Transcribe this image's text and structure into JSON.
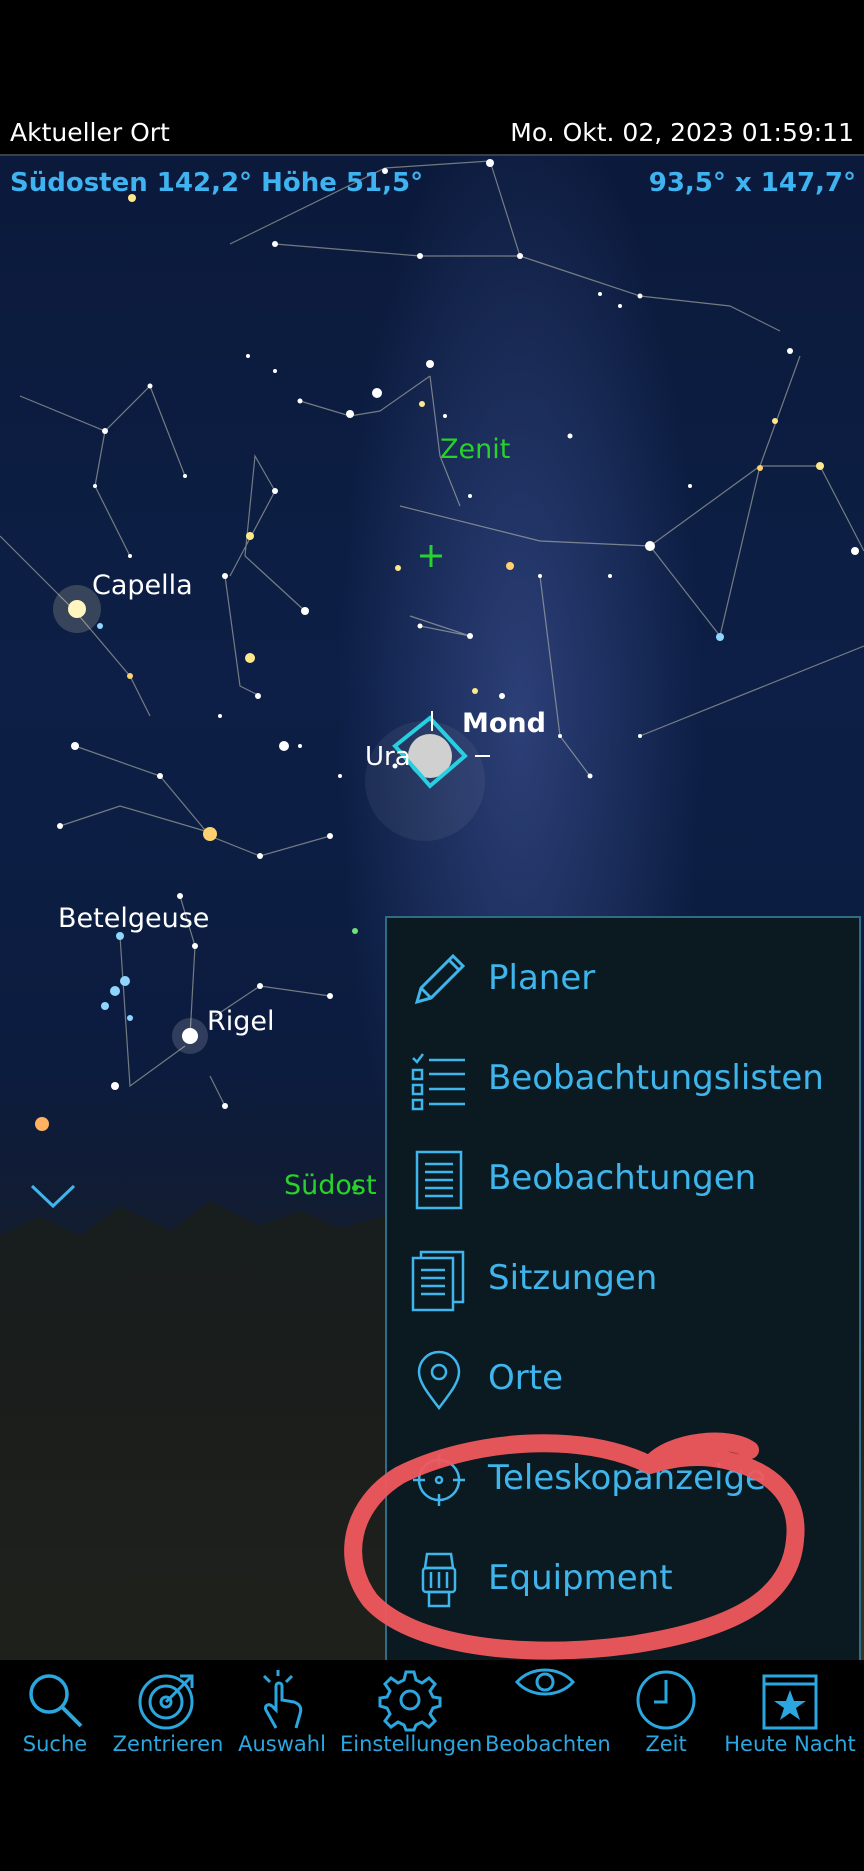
{
  "header": {
    "location": "Aktueller Ort",
    "datetime": "Mo. Okt. 02, 2023  01:59:11"
  },
  "sky": {
    "direction_info": "Südosten  142,2° Höhe 51,5°",
    "fov_info": "93,5° x 147,7°",
    "labels": {
      "zenit": "Zenit",
      "capella": "Capella",
      "mond": "Mond",
      "uranus": "Ura",
      "betelgeuse": "Betelgeuse",
      "rigel": "Rigel",
      "horizon": "Südost"
    }
  },
  "menu": {
    "items": [
      {
        "label": "Planer",
        "icon": "pencil-icon"
      },
      {
        "label": "Beobachtungslisten",
        "icon": "checklist-icon"
      },
      {
        "label": "Beobachtungen",
        "icon": "document-icon"
      },
      {
        "label": "Sitzungen",
        "icon": "documents-stack-icon"
      },
      {
        "label": "Orte",
        "icon": "location-pin-icon"
      },
      {
        "label": "Teleskopanzeige",
        "icon": "telescope-reticle-icon"
      },
      {
        "label": "Equipment",
        "icon": "eyepiece-icon"
      }
    ]
  },
  "toolbar": {
    "items": [
      {
        "label": "Suche",
        "icon": "search-icon"
      },
      {
        "label": "Zentrieren",
        "icon": "target-icon"
      },
      {
        "label": "Auswahl",
        "icon": "hand-pointer-icon"
      },
      {
        "label": "Einstellungen",
        "icon": "gear-icon"
      },
      {
        "label": "Beobachten",
        "icon": "eye-icon"
      },
      {
        "label": "Zeit",
        "icon": "clock-icon"
      },
      {
        "label": "Heute Nacht",
        "icon": "star-calendar-icon"
      }
    ]
  },
  "colors": {
    "accent": "#3fb5ec",
    "green": "#28d22a",
    "annotation": "#f0585e",
    "menu_bg": "#0a1a20"
  }
}
